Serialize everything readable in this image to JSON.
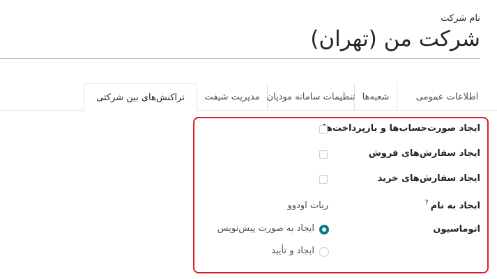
{
  "header": {
    "company_field_label": "نام شرکت",
    "company_name": "شرکت من (تهران)"
  },
  "tabs": [
    {
      "label": "اطلاعات عمومی",
      "active": false
    },
    {
      "label": "شعبه‌ها",
      "active": false
    },
    {
      "label": "تنظیمات سامانه مودیان",
      "active": false
    },
    {
      "label": "مدیریت شیفت",
      "active": false
    },
    {
      "label": "تراکنش‌های بین شرکتی",
      "active": true
    }
  ],
  "intercompany": {
    "create_invoices_label": "ایجاد صورت‌حساب‌ها و بازپرداخت‌ها",
    "create_invoices_checked": false,
    "create_sales_orders_label": "ایجاد سفارش‌های فروش",
    "create_sales_orders_checked": false,
    "create_purchase_orders_label": "ایجاد سفارش‌های خرید",
    "create_purchase_orders_checked": false,
    "create_as_label": "ایجاد به نام",
    "create_as_help": "?",
    "create_as_value": "ربات اودوو",
    "automation_label": "اتوماسیون",
    "automation_options": [
      {
        "label": "ایجاد به صورت پیش‌نویس",
        "selected": true
      },
      {
        "label": "ایجاد و تأیید",
        "selected": false
      }
    ]
  },
  "colors": {
    "highlight_border": "#e01b24",
    "radio_accent": "#017e84"
  }
}
